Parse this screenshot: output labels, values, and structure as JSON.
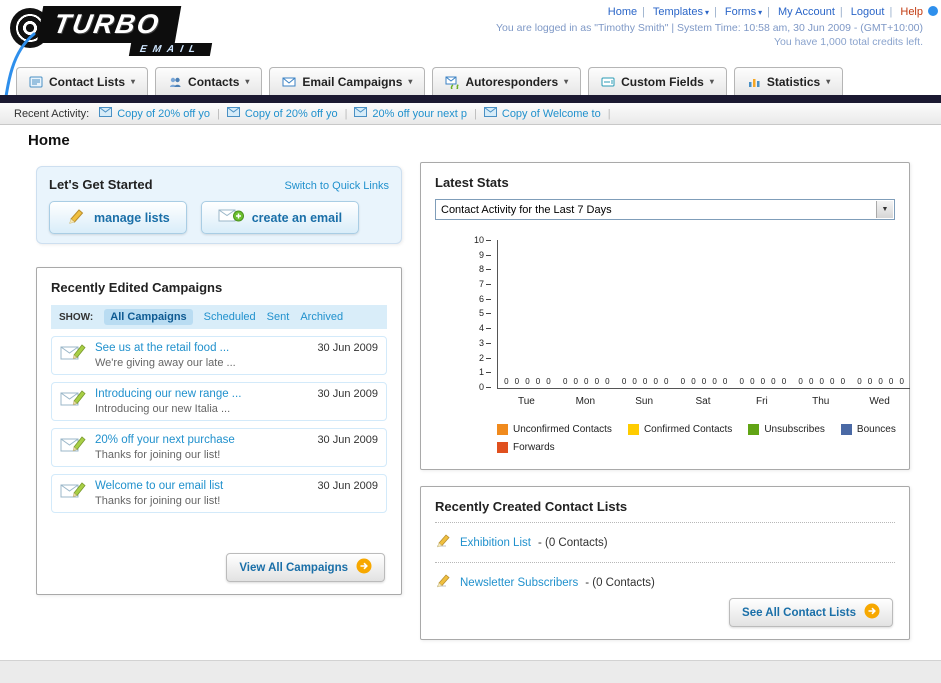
{
  "logo": {
    "main": "TURBO",
    "sub": "EMAIL"
  },
  "header": {
    "links": [
      {
        "label": "Home"
      },
      {
        "label": "Templates"
      },
      {
        "label": "Forms"
      },
      {
        "label": "My Account"
      },
      {
        "label": "Logout"
      },
      {
        "label": "Help"
      }
    ],
    "login_info": "You are logged in as \"Timothy Smith\" | System Time: 10:58 am, 30 Jun 2009 - (GMT+10:00)",
    "credits": "You have 1,000 total credits left."
  },
  "nav": {
    "tabs": [
      {
        "label": "Contact Lists"
      },
      {
        "label": "Contacts"
      },
      {
        "label": "Email Campaigns"
      },
      {
        "label": "Autoresponders"
      },
      {
        "label": "Custom Fields"
      },
      {
        "label": "Statistics"
      }
    ]
  },
  "activity": {
    "label": "Recent Activity:",
    "items": [
      "Copy of 20% off yo",
      "Copy of 20% off yo",
      "20% off your next p",
      "Copy of Welcome to"
    ]
  },
  "page_title": "Home",
  "get_started": {
    "title": "Let's Get Started",
    "switch_link": "Switch to Quick Links",
    "manage_btn": "manage lists",
    "create_btn": "create an email"
  },
  "campaigns": {
    "title": "Recently Edited Campaigns",
    "show_label": "SHOW:",
    "filters": [
      "All Campaigns",
      "Scheduled",
      "Sent",
      "Archived"
    ],
    "items": [
      {
        "title": "See us at the retail food ...",
        "subtitle": "We're giving away our late ...",
        "date": "30 Jun 2009"
      },
      {
        "title": "Introducing our new range ...",
        "subtitle": "Introducing our new Italia ...",
        "date": "30 Jun 2009"
      },
      {
        "title": "20% off your next purchase",
        "subtitle": "Thanks for joining our list!",
        "date": "30 Jun 2009"
      },
      {
        "title": "Welcome to our email list",
        "subtitle": "Thanks for joining our list!",
        "date": "30 Jun 2009"
      }
    ],
    "view_all": "View All Campaigns"
  },
  "stats": {
    "title": "Latest Stats",
    "selector": "Contact Activity for the Last 7 Days",
    "chart_data": {
      "type": "bar",
      "title": "Contact Activity for the Last 7 Days",
      "categories": [
        "Tue",
        "Mon",
        "Sun",
        "Sat",
        "Fri",
        "Thu",
        "Wed"
      ],
      "series": [
        {
          "name": "Unconfirmed Contacts",
          "color": "#f08a1d",
          "values": [
            0,
            0,
            0,
            0,
            0,
            0,
            0
          ]
        },
        {
          "name": "Confirmed Contacts",
          "color": "#ffcc00",
          "values": [
            0,
            0,
            0,
            0,
            0,
            0,
            0
          ]
        },
        {
          "name": "Unsubscribes",
          "color": "#61a415",
          "values": [
            0,
            0,
            0,
            0,
            0,
            0,
            0
          ]
        },
        {
          "name": "Bounces",
          "color": "#4a69a5",
          "values": [
            0,
            0,
            0,
            0,
            0,
            0,
            0
          ]
        },
        {
          "name": "Forwards",
          "color": "#e0501e",
          "values": [
            0,
            0,
            0,
            0,
            0,
            0,
            0
          ]
        }
      ],
      "ylim": [
        0,
        10
      ],
      "xlabel": "",
      "ylabel": "",
      "grid": false,
      "legend_position": "bottom"
    }
  },
  "lists": {
    "title": "Recently Created Contact Lists",
    "items": [
      {
        "name": "Exhibition List",
        "count": "- (0 Contacts)"
      },
      {
        "name": "Newsletter Subscribers",
        "count": "- (0 Contacts)"
      }
    ],
    "see_all": "See All Contact Lists"
  }
}
